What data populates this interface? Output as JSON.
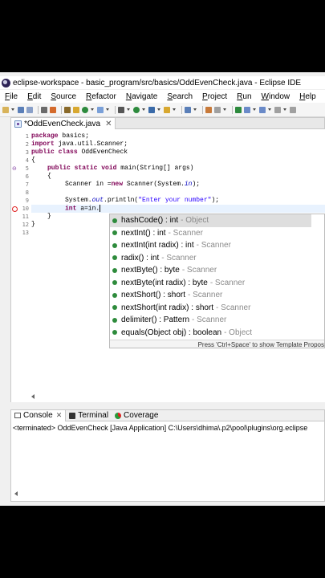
{
  "window": {
    "title": "eclipse-workspace - basic_program/src/basics/OddEvenCheck.java - Eclipse IDE"
  },
  "menu": [
    "File",
    "Edit",
    "Source",
    "Refactor",
    "Navigate",
    "Search",
    "Project",
    "Run",
    "Window",
    "Help"
  ],
  "editor": {
    "tab_label": "*OddEvenCheck.java",
    "tab_close": "✕",
    "line_numbers": [
      "1",
      "2",
      "3",
      "4",
      "5",
      "6",
      "7",
      "8",
      "9",
      "10",
      "11",
      "12",
      "13"
    ],
    "code": {
      "l1_kw": "package",
      "l1_rest": " basics;",
      "l2_kw": "import",
      "l2_rest": " java.util.Scanner;",
      "l3_kw1": "public",
      "l3_kw2": "class",
      "l3_rest": " OddEvenCheck",
      "l4": "{",
      "l5_kw1": "public",
      "l5_kw2": "static",
      "l5_kw3": "void",
      "l5_rest": " main(String[] args)",
      "l6": "{",
      "l7_a": "Scanner in =",
      "l7_kw": "new",
      "l7_b": " Scanner(System.",
      "l7_fld": "in",
      "l7_c": ");",
      "l9_a": "System.",
      "l9_fld": "out",
      "l9_b": ".println(",
      "l9_str": "\"Enter your number\"",
      "l9_c": ");",
      "l10_kw": "int",
      "l10_rest": " a=in.",
      "l11": "}",
      "l12": "}"
    }
  },
  "autocomplete": {
    "items": [
      {
        "name": "hashCode() : int",
        "owner": "- Object",
        "selected": true
      },
      {
        "name": "nextInt() : int",
        "owner": "- Scanner"
      },
      {
        "name": "nextInt(int radix) : int",
        "owner": "- Scanner"
      },
      {
        "name": "radix() : int",
        "owner": "- Scanner"
      },
      {
        "name": "nextByte() : byte",
        "owner": "- Scanner"
      },
      {
        "name": "nextByte(int radix) : byte",
        "owner": "- Scanner"
      },
      {
        "name": "nextShort() : short",
        "owner": "- Scanner"
      },
      {
        "name": "nextShort(int radix) : short",
        "owner": "- Scanner"
      },
      {
        "name": "delimiter() : Pattern",
        "owner": "- Scanner"
      },
      {
        "name": "equals(Object obj) : boolean",
        "owner": "- Object"
      }
    ],
    "footer": "Press 'Ctrl+Space' to show Template Propos"
  },
  "console": {
    "tabs": [
      {
        "label": "Console",
        "close": "✕"
      },
      {
        "label": "Terminal"
      },
      {
        "label": "Coverage"
      }
    ],
    "text": "<terminated> OddEvenCheck [Java Application] C:\\Users\\dhima\\.p2\\pool\\plugins\\org.eclipse"
  },
  "colors": {
    "keyword": "#7f0055",
    "string": "#2a00ff",
    "field": "#0000c0",
    "selection": "#dedede"
  },
  "icons": [
    "eclipse-icon",
    "java-file-icon",
    "method-public-icon",
    "console-icon",
    "terminal-icon",
    "coverage-icon"
  ]
}
